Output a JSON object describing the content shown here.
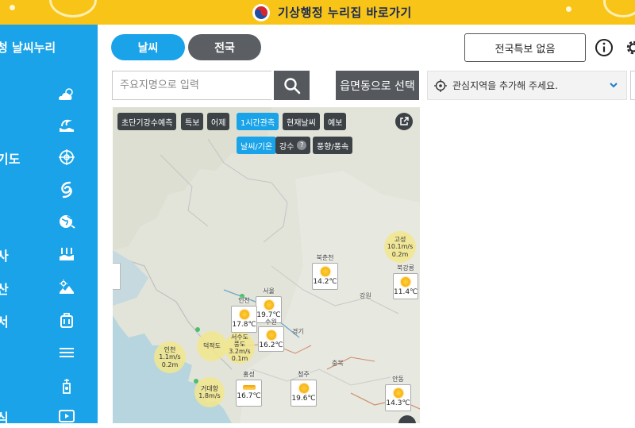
{
  "banner": {
    "text": "기상행정 누리집 바로가기"
  },
  "sidebar": {
    "brand": "청 날씨누리",
    "items": [
      {
        "label": "",
        "icon": "sun-cloud-icon"
      },
      {
        "label": "",
        "icon": "wave-icon"
      },
      {
        "label": "기도",
        "icon": "radar-icon"
      },
      {
        "label": "",
        "icon": "typhoon-icon"
      },
      {
        "label": "",
        "icon": "globe-icon"
      },
      {
        "label": "사",
        "icon": "water-level-icon"
      },
      {
        "label": "산",
        "icon": "mountain-sun-icon"
      },
      {
        "label": "서",
        "icon": "luggage-icon"
      },
      {
        "label": "",
        "icon": "menu-lines-icon"
      },
      {
        "label": "",
        "icon": "farm-icon"
      },
      {
        "label": "식",
        "icon": "video-icon"
      }
    ]
  },
  "header": {
    "tab_weather": "날씨",
    "tab_nationwide": "전국",
    "warning_button": "전국특보 없음"
  },
  "search": {
    "placeholder": "주요지명으로 입력",
    "region_button": "읍면동으로 선택"
  },
  "interest": {
    "placeholder": "관심지역을 추가해 주세요."
  },
  "map": {
    "tabs": [
      "초단기강수예측",
      "특보",
      "어제",
      "1시간관측",
      "현재날씨",
      "예보"
    ],
    "active_tab": "1시간관측",
    "subtabs": [
      "날씨/기온",
      "강수",
      "풍향/풍속"
    ],
    "active_subtab": "날씨/기온",
    "stations": [
      {
        "name": "북춘천",
        "temp": "14.2℃"
      },
      {
        "name": "북강릉",
        "temp": "11.4℃"
      },
      {
        "name": "서울",
        "temp": "19.7℃"
      },
      {
        "name": "인천",
        "temp": "17.8℃"
      },
      {
        "name": "수원",
        "temp": "16.2℃"
      },
      {
        "name": "홍성",
        "temp": "16.7℃"
      },
      {
        "name": "청주",
        "temp": "19.6℃"
      },
      {
        "name": "안동",
        "temp": "14.3℃"
      }
    ],
    "wind_bubbles": [
      {
        "name": "고성",
        "l1": "10.1m/s",
        "l2": "0.2m"
      },
      {
        "name": "인천",
        "l1": "1.1m/s",
        "l2": "0.2m"
      },
      {
        "name": "덕적도",
        "l1": "",
        "l2": ""
      },
      {
        "name": "서수도",
        "l1": "3.2m/s",
        "l2": "0.1m"
      },
      {
        "name": "풍도",
        "l1": "",
        "l2": ""
      },
      {
        "name": "거대항",
        "l1": "1.8m/s",
        "l2": ""
      }
    ],
    "place_labels": [
      "강원",
      "경기",
      "충북"
    ]
  },
  "colors": {
    "accent": "#1aa3e8",
    "banner": "#f7c417",
    "dark_button": "#55595d"
  }
}
